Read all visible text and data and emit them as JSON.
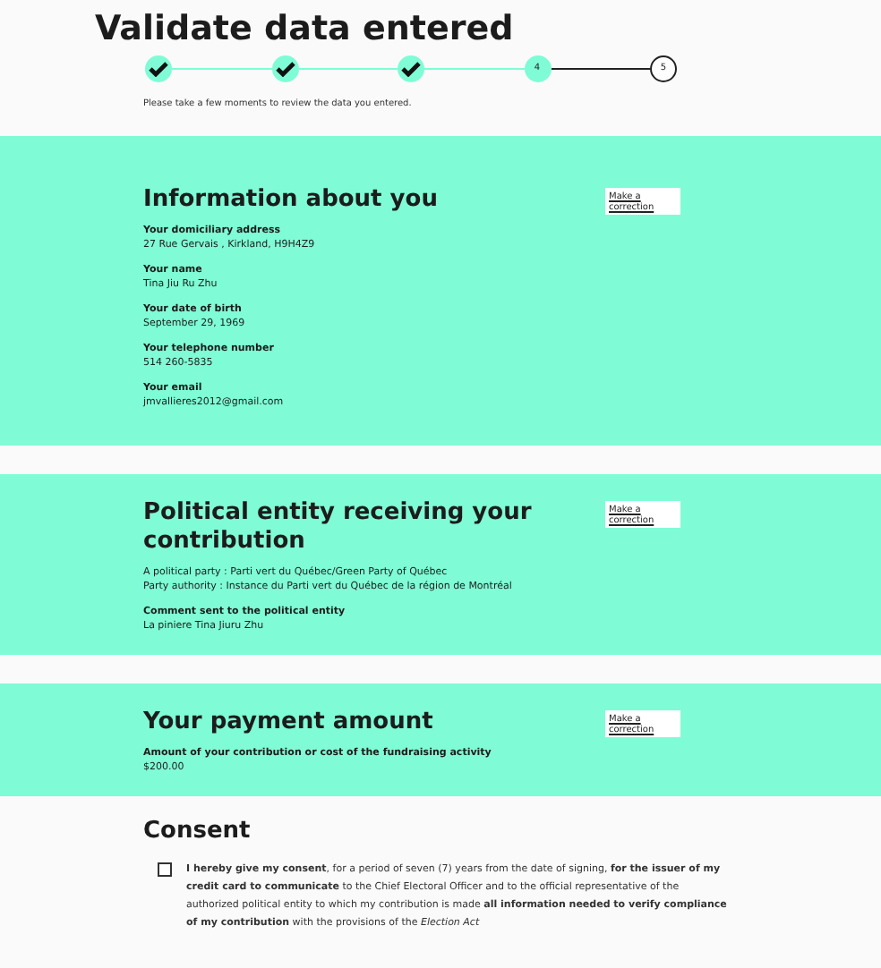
{
  "title": "Validate data entered",
  "steps": [
    {
      "kind": "done"
    },
    {
      "kind": "done"
    },
    {
      "kind": "done"
    },
    {
      "kind": "current",
      "label": "4"
    },
    {
      "kind": "todo",
      "label": "5"
    }
  ],
  "intro": "Please take a few moments to review the data you entered.",
  "sections": [
    {
      "heading": "Information about you",
      "button": "Make a correction",
      "items": [
        {
          "kind": "field",
          "label": "Your domiciliary address",
          "value": "27 Rue Gervais , Kirkland, H9H4Z9"
        },
        {
          "kind": "field",
          "label": "Your name",
          "value": "Tina Jiu Ru Zhu"
        },
        {
          "kind": "field",
          "label": "Your date of birth",
          "value": "September 29, 1969"
        },
        {
          "kind": "field",
          "label": "Your telephone number",
          "value": "514 260-5835"
        },
        {
          "kind": "field",
          "label": "Your email",
          "value": "jmvallieres2012@gmail.com"
        }
      ]
    },
    {
      "heading": "Political entity receiving your contribution",
      "button": "Make a correction",
      "items": [
        {
          "kind": "lines",
          "lines": [
            "A political party : Parti vert du Québec/Green Party of Québec",
            "Party authority : Instance du Parti vert du Québec de la région de Montréal"
          ]
        },
        {
          "kind": "field",
          "label": "Comment sent to the political entity",
          "value": "La piniere Tina Jiuru Zhu"
        }
      ]
    },
    {
      "heading": "Your payment amount",
      "button": "Make a correction",
      "items": [
        {
          "kind": "field",
          "label": "Amount of your contribution or cost of the fundraising activity",
          "value": "$200.00"
        }
      ]
    }
  ],
  "consent": {
    "heading": "Consent",
    "checked": false,
    "text": "**I hereby give my consent**, for a period of seven (7) years from the date of signing, **for the issuer of my credit card to communicate** to the Chief Electoral Officer and to the official representative of the authorized political entity to which my contribution is made **all information needed to verify compliance of my contribution** with the provisions of the *Election Act*"
  }
}
